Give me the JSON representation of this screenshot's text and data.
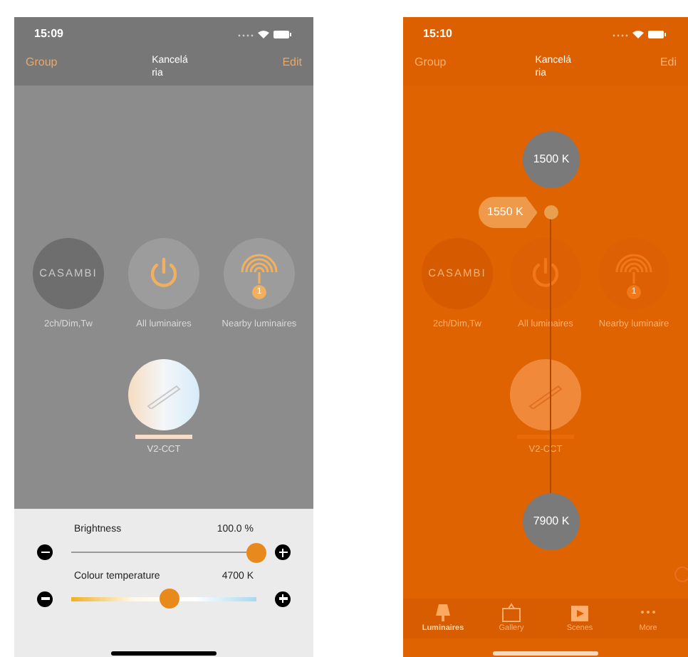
{
  "left_screen": {
    "status_bar": {
      "time": "15:09"
    },
    "nav": {
      "left": "Group",
      "title_lines": [
        "Kancelá",
        "ria"
      ],
      "right": "Edit"
    },
    "tiles": [
      {
        "kind": "logo",
        "logo_text": "CASAMBI",
        "label": "2ch/Dim,Tw"
      },
      {
        "kind": "power",
        "label": "All luminaires"
      },
      {
        "kind": "nearby",
        "badge": "1",
        "label": "Nearby luminaires"
      }
    ],
    "luminaire": {
      "label": "V2-CCT"
    },
    "controls": [
      {
        "kind": "plain",
        "label": "Brightness",
        "reading": "100.0 %",
        "level": 1.0
      },
      {
        "kind": "temperature",
        "label": "Colour temperature",
        "reading": "4700 K",
        "level": 0.53
      }
    ]
  },
  "right_screen": {
    "status_bar": {
      "time": "15:10"
    },
    "nav": {
      "left": "Group",
      "title_lines": [
        "Kancelá",
        "ria"
      ],
      "right": "Edi"
    },
    "tiles": [
      {
        "kind": "logo",
        "logo_text": "CASAMBI",
        "label": "2ch/Dim,Tw"
      },
      {
        "kind": "power",
        "label": "All luminaires"
      },
      {
        "kind": "nearby",
        "badge": "1",
        "label": "Nearby luminaire"
      }
    ],
    "luminaire": {
      "label": "V2-CCT"
    },
    "temperature_scale": {
      "top": "1500 K",
      "bottom": "7900 K",
      "marker": "1550 K",
      "level": 0.08
    },
    "tab_bar": [
      {
        "kind": "lamp",
        "label": "Luminaires",
        "selected": true
      },
      {
        "kind": "gallery",
        "label": "Gallery",
        "selected": false
      },
      {
        "kind": "scenes",
        "label": "Scenes",
        "selected": false
      },
      {
        "kind": "more",
        "label": "More",
        "selected": false
      }
    ]
  }
}
